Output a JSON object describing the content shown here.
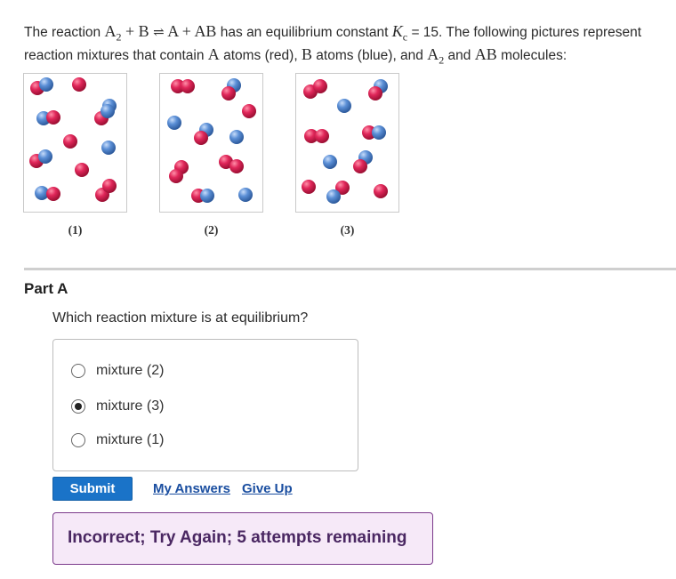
{
  "intro": {
    "prefix": "The reaction",
    "species_A2_base": "A",
    "species_A2_sub": "2",
    "plus1": "+",
    "species_B": "B",
    "equilibrium_arrow": "⇌",
    "species_A": "A",
    "plus2": "+",
    "species_AB": "AB",
    "middle": "has an equilibrium constant",
    "k_symbol": "K",
    "k_sub": "c",
    "k_value": "= 15. The following pictures represent reaction mixtures that contain",
    "atom_A": "A",
    "text_atoms_red": "atoms (red),",
    "atom_B": "B",
    "text_atoms_blue": "atoms (blue), and",
    "mol_A2_base": "A",
    "mol_A2_sub": "2",
    "text_and": "and",
    "mol_AB": "AB",
    "text_molecules": "molecules:"
  },
  "figures": {
    "labels": [
      "(1)",
      "(2)",
      "(3)"
    ],
    "colors": {
      "red_atom": "#d8204e",
      "blue_atom": "#4f86cf"
    }
  },
  "part": {
    "title": "Part A",
    "question": "Which reaction mixture is at equilibrium?"
  },
  "choices": [
    {
      "label": "mixture (2)",
      "selected": false
    },
    {
      "label": "mixture (3)",
      "selected": true
    },
    {
      "label": "mixture (1)",
      "selected": false
    }
  ],
  "actions": {
    "submit": "Submit",
    "my_answers": "My Answers",
    "give_up": "Give Up"
  },
  "feedback": {
    "message": "Incorrect; Try Again; 5 attempts remaining",
    "color": "#7b3a8b"
  }
}
